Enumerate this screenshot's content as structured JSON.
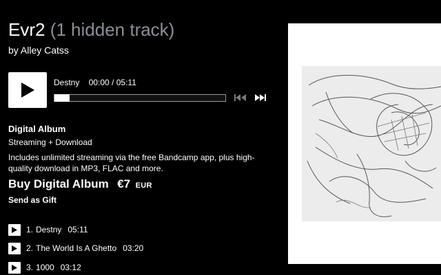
{
  "album": {
    "title": "Evr2",
    "hidden_tracks": "(1 hidden track)",
    "artist_line": "by Alley Catss"
  },
  "player": {
    "track_title": "Destny",
    "time": "00:00 / 05:11",
    "progress_fraction": 0.0,
    "play_icon": "play-icon",
    "prev_icon": "skip-previous-icon",
    "next_icon": "skip-next-icon"
  },
  "purchase": {
    "label": "Digital Album",
    "format": "Streaming + Download",
    "description": "Includes unlimited streaming via the free Bandcamp app, plus high-quality download in MP3, FLAC and more.",
    "buy_label": "Buy Digital Album",
    "price": "€7",
    "currency": "EUR",
    "gift_label": "Send as Gift"
  },
  "tracks": [
    {
      "number": "1.",
      "title": "Destny",
      "duration": "05:11"
    },
    {
      "number": "2.",
      "title": "The World Is A Ghetto",
      "duration": "03:20"
    },
    {
      "number": "3.",
      "title": "1000",
      "duration": "03:12"
    }
  ],
  "colors": {
    "background": "#000000",
    "text": "#ffffff",
    "muted": "#8a8f96",
    "disabled_control": "#7a7a7a"
  }
}
